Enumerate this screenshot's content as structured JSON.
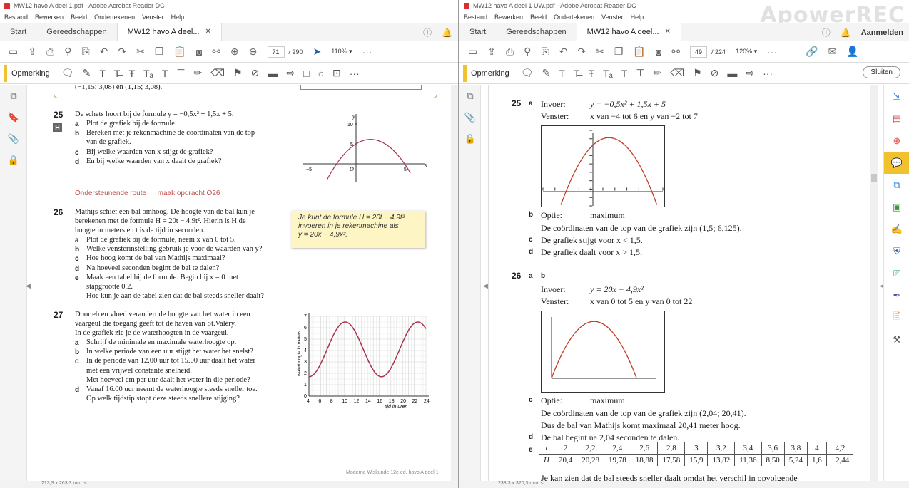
{
  "left": {
    "title": "MW12 havo A deel 1.pdf - Adobe Acrobat Reader DC",
    "menu": [
      "Bestand",
      "Bewerken",
      "Beeld",
      "Ondertekenen",
      "Venster",
      "Help"
    ],
    "tabs": {
      "home": "Start",
      "tools": "Gereedschappen",
      "doc": "MW12 havo A deel..."
    },
    "page": {
      "current": "71",
      "total": "/ 290",
      "zoom": "110%"
    },
    "anno_label": "Opmerking",
    "status": "213,3 x 263,3 mm",
    "content": {
      "top_text": "(−1,15; 3,08) en (1,15; 3,08).",
      "q25": {
        "num": "25",
        "badge": "H",
        "stem": "De schets hoort bij de formule y = −0,5x² + 1,5x + 5.",
        "items": [
          {
            "l": "a",
            "t": "Plot de grafiek bij de formule."
          },
          {
            "l": "b",
            "t": "Bereken met je rekenmachine de coördinaten van de top"
          },
          {
            "l": "",
            "t": "van de grafiek."
          },
          {
            "l": "c",
            "t": "Bij welke waarden van x stijgt de grafiek?"
          },
          {
            "l": "d",
            "t": "En bij welke waarden van x daalt de grafiek?"
          }
        ]
      },
      "graph25": {
        "y_label": "y",
        "x_label": "x",
        "tick_y10": "10",
        "tick_y5": "5",
        "tick_xm5": "−5",
        "tick_o": "O",
        "tick_x5": "5"
      },
      "route": "Ondersteunende route → maak opdracht O26",
      "q26": {
        "num": "26",
        "lines": [
          "Mathijs schiet een bal omhoog. De hoogte van de bal kun je",
          "berekenen met de formule H = 20t − 4,9t². Hierin is H de",
          "hoogte in meters en t is de tijd in seconden."
        ],
        "items": [
          {
            "l": "a",
            "t": "Plot de grafiek bij de formule, neem x van 0 tot 5."
          },
          {
            "l": "b",
            "t": "Welke vensterinstelling gebruik je voor de waarden van y?"
          },
          {
            "l": "c",
            "t": "Hoe hoog komt de bal van Mathijs maximaal?"
          },
          {
            "l": "d",
            "t": "Na hoeveel seconden begint de bal te dalen?"
          },
          {
            "l": "e",
            "t": "Maak een tabel bij de formule. Begin bij x = 0 met"
          },
          {
            "l": "",
            "t": "stapgrootte 0,2."
          },
          {
            "l": "",
            "t": "Hoe kun je aan de tabel zien dat de bal steeds sneller daalt?"
          }
        ]
      },
      "note": [
        "Je kunt de formule H = 20t − 4,9t²",
        "invoeren in je rekenmachine als",
        "y = 20x − 4,9x²."
      ],
      "q27": {
        "num": "27",
        "lines": [
          "Door eb en vloed verandert de hoogte van het water in een",
          "vaargeul die toegang geeft tot de haven van St.Valéry.",
          "In de grafiek zie je de waterhoogten in de vaargeul."
        ],
        "items": [
          {
            "l": "a",
            "t": "Schrijf de minimale en maximale waterhoogte op."
          },
          {
            "l": "b",
            "t": "In welke periode van een uur stijgt het water het snelst?"
          },
          {
            "l": "c",
            "t": "In de periode van 12.00 uur tot 15.00 uur daalt het water"
          },
          {
            "l": "",
            "t": "met een vrijwel constante snelheid."
          },
          {
            "l": "",
            "t": "Met hoeveel cm per uur daalt het water in die periode?"
          },
          {
            "l": "d",
            "t": "Vanaf 16.00 uur neemt de waterhoogte steeds sneller toe."
          },
          {
            "l": "",
            "t": "Op welk tijdstip stopt deze steeds snellere stijging?"
          }
        ]
      },
      "graph27": {
        "ylabel": "waterhoogte in meters",
        "xlabel": "tijd in uren",
        "xticks": [
          "4",
          "6",
          "8",
          "10",
          "12",
          "14",
          "16",
          "18",
          "20",
          "22",
          "24"
        ],
        "yticks": [
          "0",
          "1",
          "2",
          "3",
          "4",
          "5",
          "6",
          "7"
        ]
      },
      "footer": "Moderne Wiskunde 12e ed. havo A deel 1"
    }
  },
  "right": {
    "title": "MW12 havo A deel 1 UW.pdf - Adobe Acrobat Reader DC",
    "watermark": "ApowerREC",
    "menu": [
      "Bestand",
      "Bewerken",
      "Beeld",
      "Ondertekenen",
      "Venster",
      "Help"
    ],
    "tabs": {
      "home": "Start",
      "tools": "Gereedschappen",
      "doc": "MW12 havo A deel..."
    },
    "signin": "Aanmelden",
    "page": {
      "current": "49",
      "total": "/ 224",
      "zoom": "120%"
    },
    "anno_label": "Opmerking",
    "close_label": "Sluiten",
    "status": "233,3 x 320,3 mm",
    "content": {
      "a25": {
        "num": "25",
        "a": "a",
        "invoer_l": "Invoer:",
        "invoer": "y = −0,5x² + 1,5x + 5",
        "venster_l": "Venster:",
        "venster": "x van −4 tot 6 en y van −2 tot 7",
        "b": "b",
        "optie_l": "Optie:",
        "optie": "maximum",
        "b_line": "De coördinaten van de top van de grafiek zijn (1,5; 6,125).",
        "c": "c",
        "c_line": "De grafiek stijgt voor x < 1,5.",
        "d": "d",
        "d_line": "De grafiek daalt voor x > 1,5."
      },
      "a26": {
        "num": "26",
        "a": "a",
        "b": "b",
        "invoer_l": "Invoer:",
        "invoer": "y = 20x − 4,9x²",
        "venster_l": "Venster:",
        "venster": "x van 0 tot 5 en y van 0 tot 22",
        "c": "c",
        "optie_l": "Optie:",
        "optie": "maximum",
        "c_line1": "De coördinaten van de top van de grafiek zijn (2,04; 20,41).",
        "c_line2": "Dus de bal van Mathijs komt maximaal 20,41 meter hoog.",
        "d": "d",
        "d_line": "De bal begint na 2,04 seconden te dalen.",
        "e": "e",
        "table": {
          "t": [
            "t",
            "2",
            "2,2",
            "2,4",
            "2,6",
            "2,8",
            "3",
            "3,2",
            "3,4",
            "3,6",
            "3,8",
            "4",
            "4,2"
          ],
          "H": [
            "H",
            "20,4",
            "20,28",
            "19,78",
            "18,88",
            "17,58",
            "15,9",
            "13,82",
            "11,36",
            "8,50",
            "5,24",
            "1,6",
            "−2,44"
          ]
        },
        "cut_line": "Je kan zien dat de bal steeds sneller daalt omdat het verschil in opvolgende"
      }
    }
  }
}
